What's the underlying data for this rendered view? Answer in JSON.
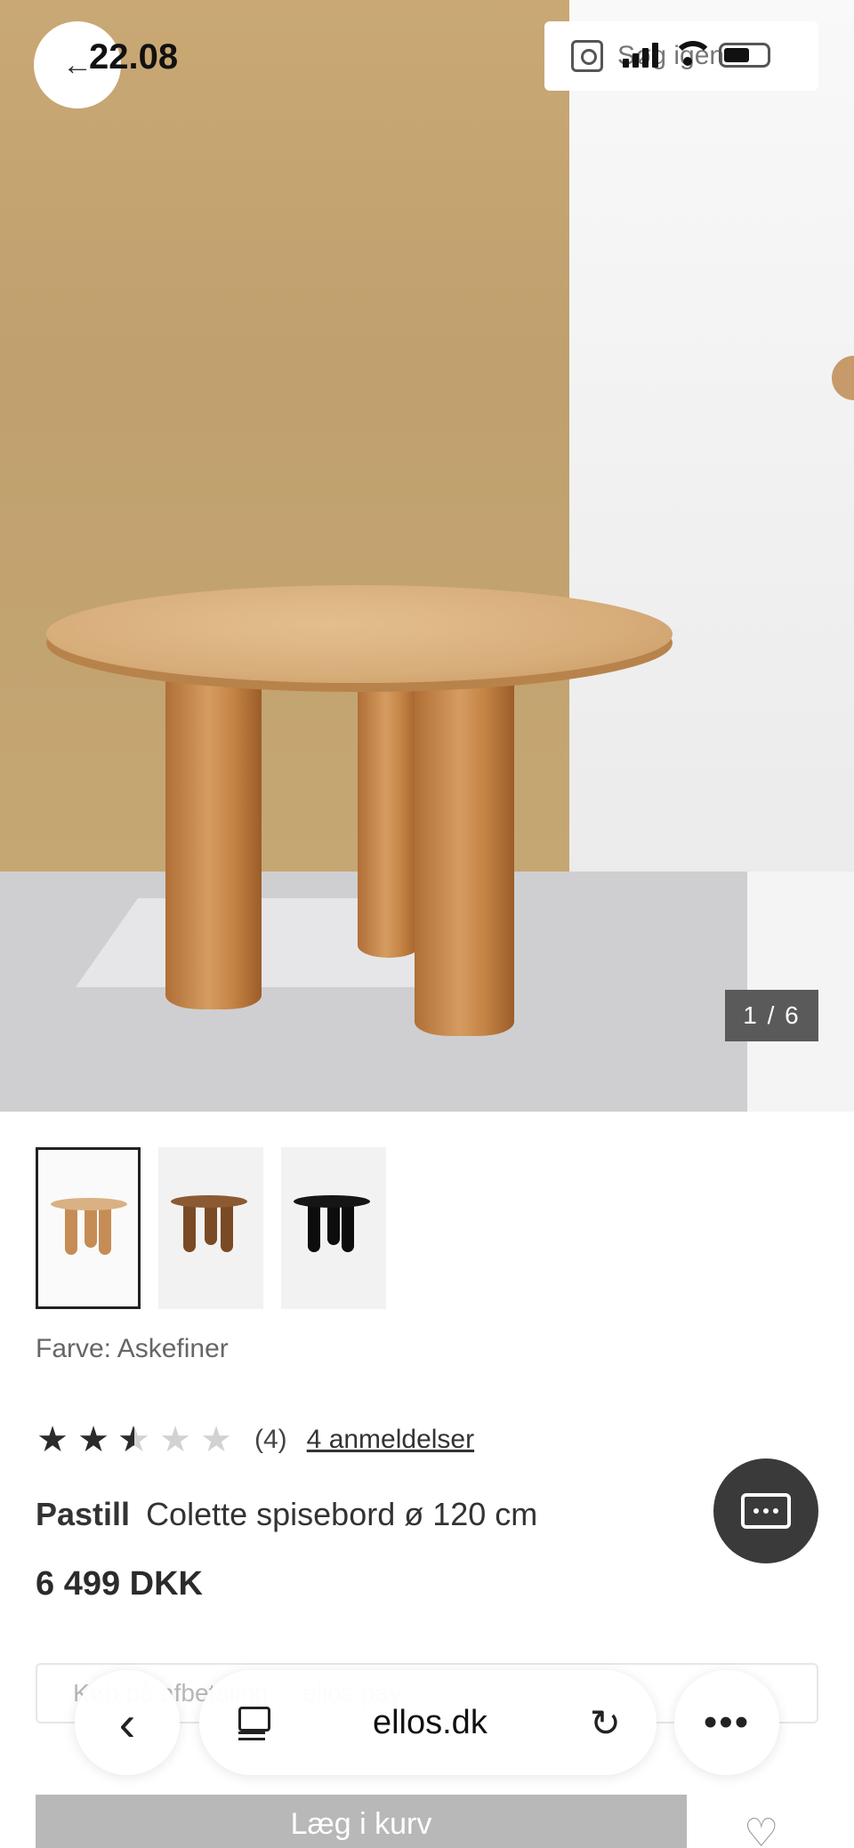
{
  "status_bar": {
    "time": "22.08",
    "search_text": "Søg igen"
  },
  "gallery": {
    "counter": "1 / 6",
    "thumbnails": [
      "Askefiner",
      "Medium",
      "Sort"
    ]
  },
  "product": {
    "color_label": "Farve: Askefiner",
    "rating_value": 2.5,
    "rating_count": "(4)",
    "reviews_link": "4 anmeldelser",
    "brand": "Pastill",
    "name": "Colette spisebord ø 120 cm",
    "price": "6 499 DKK"
  },
  "payment_text": "Køb på afbetaling ... ellos pay",
  "browser": {
    "url": "ellos.dk",
    "back": "‹",
    "reload": "↻",
    "more": "•••"
  },
  "actions": {
    "add_to_cart": "Læg i kurv",
    "favorite": "♡"
  },
  "icons": [
    "back-arrow-icon",
    "search-scan-icon",
    "signal-icon",
    "wifi-icon",
    "battery-icon",
    "chat-icon",
    "star-icon",
    "tabs-icon",
    "reload-icon",
    "more-icon",
    "heart-icon"
  ]
}
